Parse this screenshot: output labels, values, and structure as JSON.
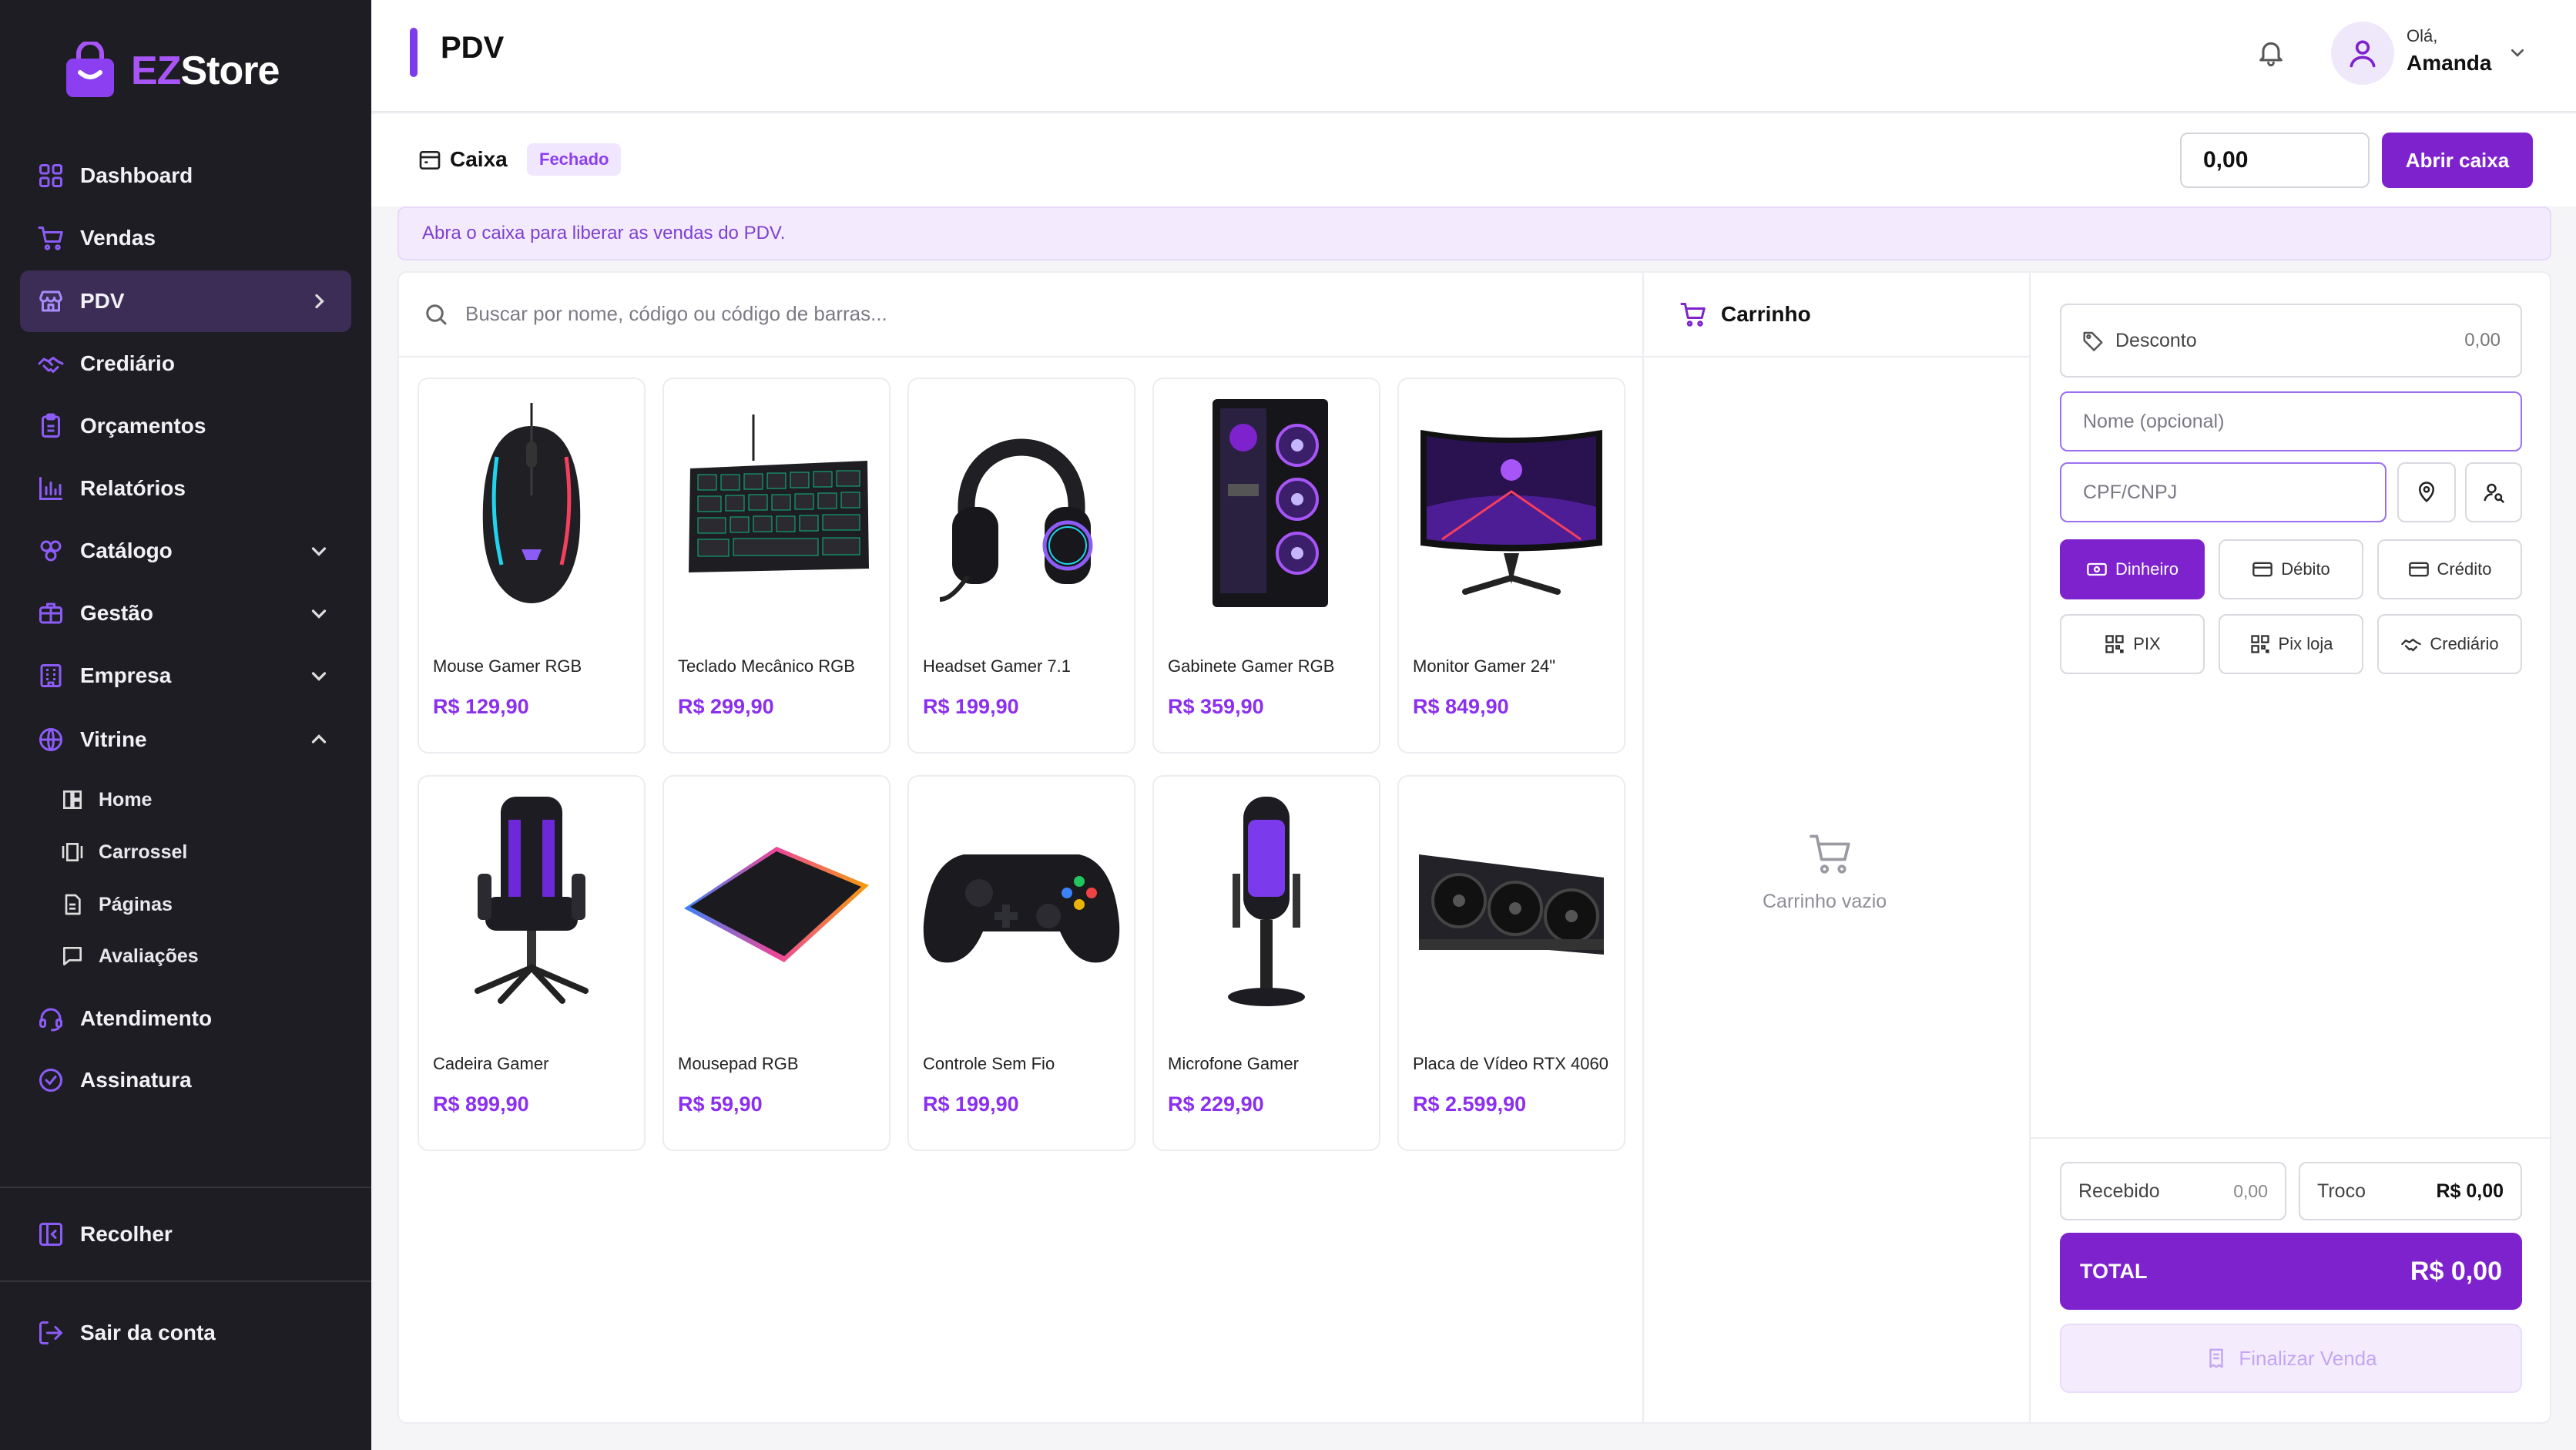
{
  "brand": {
    "ez": "EZ",
    "store": "Store"
  },
  "sidebar": {
    "items": [
      {
        "label": "Dashboard",
        "icon": "dashboard-icon"
      },
      {
        "label": "Vendas",
        "icon": "cart-icon"
      },
      {
        "label": "PDV",
        "icon": "store-icon",
        "active": true
      },
      {
        "label": "Crediário",
        "icon": "handshake-icon"
      },
      {
        "label": "Orçamentos",
        "icon": "clipboard-icon"
      },
      {
        "label": "Relatórios",
        "icon": "bar-chart-icon"
      },
      {
        "label": "Catálogo",
        "icon": "layers-icon"
      },
      {
        "label": "Gestão",
        "icon": "briefcase-icon"
      },
      {
        "label": "Empresa",
        "icon": "building-icon"
      },
      {
        "label": "Vitrine",
        "icon": "globe-icon"
      },
      {
        "label": "Atendimento",
        "icon": "headset-icon"
      },
      {
        "label": "Assinatura",
        "icon": "badge-check-icon"
      }
    ],
    "vitrine_sub": [
      {
        "label": "Home"
      },
      {
        "label": "Carrossel"
      },
      {
        "label": "Páginas"
      },
      {
        "label": "Avaliações"
      }
    ],
    "collapse": "Recolher",
    "logout": "Sair da conta"
  },
  "header": {
    "title": "PDV",
    "greeting": "Olá,",
    "user": "Amanda"
  },
  "caixa": {
    "label": "Caixa",
    "status": "Fechado",
    "amount": "0,00",
    "open_button": "Abrir caixa",
    "notice": "Abra o caixa para liberar as vendas do PDV."
  },
  "search": {
    "placeholder": "Buscar por nome, código ou código de barras..."
  },
  "products": [
    {
      "name": "Mouse Gamer RGB",
      "price": "R$ 129,90"
    },
    {
      "name": "Teclado Mecânico RGB",
      "price": "R$ 299,90"
    },
    {
      "name": "Headset Gamer 7.1",
      "price": "R$ 199,90"
    },
    {
      "name": "Gabinete Gamer RGB",
      "price": "R$ 359,90"
    },
    {
      "name": "Monitor Gamer 24\"",
      "price": "R$ 849,90"
    },
    {
      "name": "Cadeira Gamer",
      "price": "R$ 899,90"
    },
    {
      "name": "Mousepad RGB",
      "price": "R$ 59,90"
    },
    {
      "name": "Controle Sem Fio",
      "price": "R$ 199,90"
    },
    {
      "name": "Microfone Gamer",
      "price": "R$ 229,90"
    },
    {
      "name": "Placa de Vídeo RTX 4060",
      "price": "R$ 2.599,90"
    }
  ],
  "cart": {
    "title": "Carrinho",
    "empty": "Carrinho vazio"
  },
  "checkout": {
    "discount_label": "Desconto",
    "discount_value": "0,00",
    "name_placeholder": "Nome (opcional)",
    "doc_placeholder": "CPF/CNPJ",
    "payments": [
      "Dinheiro",
      "Débito",
      "Crédito",
      "PIX",
      "Pix loja",
      "Crediário"
    ],
    "received_label": "Recebido",
    "received_value": "0,00",
    "change_label": "Troco",
    "change_value": "R$ 0,00",
    "total_label": "TOTAL",
    "total_value": "R$ 0,00",
    "finish_button": "Finalizar Venda"
  },
  "colors": {
    "accent": "#7e22ce",
    "accent_light": "#a855f7",
    "sidebar_bg": "#1e1d23"
  }
}
